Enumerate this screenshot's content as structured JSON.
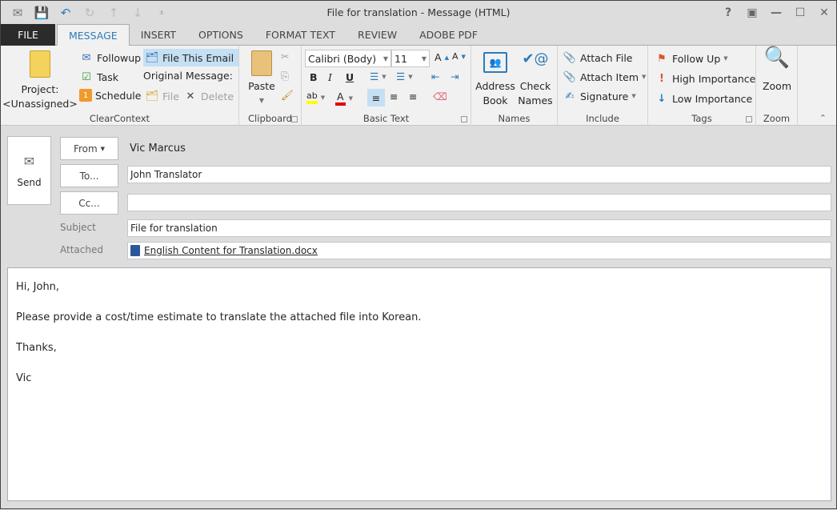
{
  "window": {
    "title": "File for translation - Message (HTML)",
    "controls": {
      "help": "?",
      "ribbon_display": "▣",
      "minimize": "—",
      "maximize": "☐",
      "close": "✕"
    }
  },
  "qat": {
    "icons": [
      "message-icon",
      "save-icon",
      "undo-icon",
      "redo-icon",
      "up-icon",
      "down-icon",
      "customize-icon"
    ]
  },
  "tabs": [
    {
      "label": "FILE"
    },
    {
      "label": "MESSAGE"
    },
    {
      "label": "INSERT"
    },
    {
      "label": "OPTIONS"
    },
    {
      "label": "FORMAT TEXT"
    },
    {
      "label": "REVIEW"
    },
    {
      "label": "ADOBE PDF"
    }
  ],
  "ribbon": {
    "clearcontext": {
      "label": "ClearContext",
      "project": "Project:",
      "project_value": "<Unassigned>",
      "followup": "Followup",
      "task": "Task",
      "schedule": "Schedule",
      "file_this_email": "File This Email",
      "original_message": "Original Message:",
      "file": "File",
      "delete": "Delete"
    },
    "clipboard": {
      "label": "Clipboard",
      "paste": "Paste"
    },
    "basic_text": {
      "label": "Basic Text",
      "font": "Calibri (Body)",
      "size": "11",
      "bold": "B",
      "italic": "I",
      "underline": "U",
      "highlight_color": "#ffff00",
      "font_color": "#e00000"
    },
    "names": {
      "label": "Names",
      "address_book": "Address Book",
      "check_names": "Check Names"
    },
    "include": {
      "label": "Include",
      "attach_file": "Attach File",
      "attach_item": "Attach Item",
      "signature": "Signature"
    },
    "tags": {
      "label": "Tags",
      "follow_up": "Follow Up",
      "high_importance": "High Importance",
      "low_importance": "Low Importance"
    },
    "zoom": {
      "label": "Zoom",
      "zoom": "Zoom"
    }
  },
  "compose": {
    "send": "Send",
    "from_label": "From",
    "from_value": "Vic Marcus",
    "to_label": "To...",
    "to_value": "John Translator",
    "cc_label": "Cc...",
    "cc_value": "",
    "subject_label": "Subject",
    "subject_value": "File for translation",
    "attached_label": "Attached",
    "attachment": "English Content for Translation.docx",
    "body": [
      "Hi, John,",
      "Please provide a cost/time estimate to translate the attached file into Korean.",
      "Thanks,",
      "Vic"
    ]
  }
}
